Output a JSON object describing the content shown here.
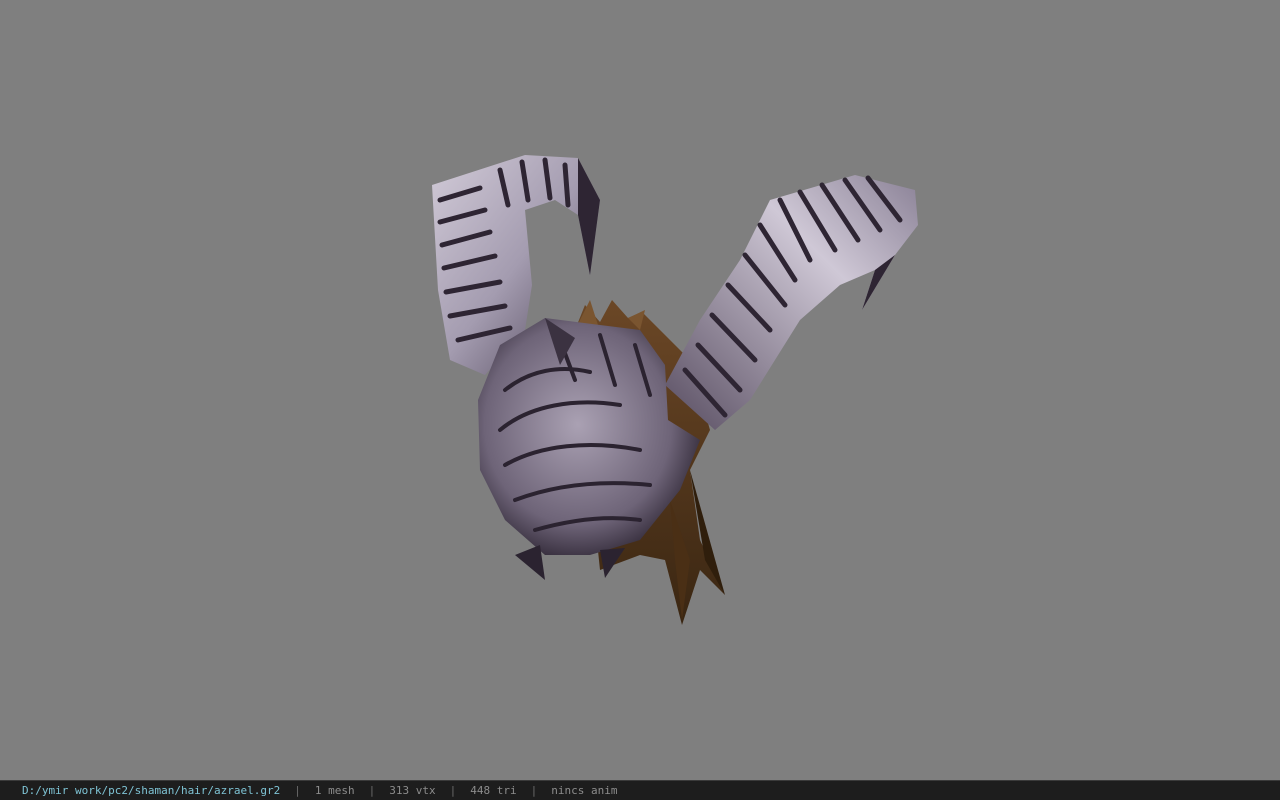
{
  "viewer": {
    "background_color": "#7f7f7f",
    "model_name": "azrael",
    "model": {
      "horn_color": "#b6aebf",
      "horn_stripe_color": "#2e2533",
      "hair_color": "#5a3a1e"
    }
  },
  "statusbar": {
    "file_path": "D:/ymir work/pc2/shaman/hair/azrael.gr2",
    "separator": "|",
    "mesh_count": "1 mesh",
    "vertex_count": "313 vtx",
    "triangle_count": "448 tri",
    "animation": "nincs anim",
    "path_color": "#7ec3d4"
  }
}
